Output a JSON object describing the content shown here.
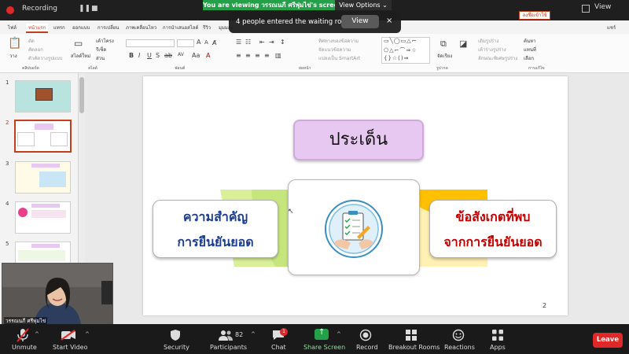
{
  "zoom_top": {
    "recording_label": "Recording",
    "viewing_banner": "You are viewing วรรณนภี ศรีพุ่มไข่'s screen",
    "view_options": "View Options",
    "view_label": "View"
  },
  "toast": {
    "message": "4 people entered the waiting room",
    "view_button": "View",
    "close": "×"
  },
  "ppt": {
    "tabs": [
      "ไฟล์",
      "หน้าแรก",
      "แทรก",
      "ออกแบบ",
      "การเปลี่ยน",
      "ภาพเคลื่อนไหว",
      "การนำเสนอสไลด์",
      "รีวิว",
      "มุมมอง"
    ],
    "share_button": "ลงชื่อเข้าใช้",
    "share_short": "แชร์",
    "groups": [
      "คลิปบอร์ด",
      "สไลด์",
      "ฟอนต์",
      "ย่อหน้า",
      "รูปวาด",
      "การแก้ไข"
    ],
    "home_buttons": {
      "paste": "วาง",
      "cut": "ตัด",
      "copy": "คัดลอก",
      "format_painter": "ตัวคัดวางรูปแบบ",
      "new_slide": "สไลด์ใหม่",
      "layout": "เค้าโครง",
      "reset": "รีเซ็ต",
      "section": "ส่วน",
      "arrange": "จัดเรียง",
      "find": "ค้นหา",
      "replace": "แทนที่",
      "select": "เลือก",
      "text_direction": "ทิศทางของข้อความ",
      "align_text": "จัดแนวข้อความ",
      "smartart": "แปลงเป็น SmartArt",
      "shape_fill": "เติมรูปร่าง",
      "shape_outline": "เค้าร่างรูปร่าง",
      "shape_effects": "ลักษณะพิเศษรูปร่าง"
    },
    "thumb_numbers": [
      "1",
      "2",
      "3",
      "4",
      "5"
    ],
    "slide": {
      "title": "ประเด็น",
      "left_line1": "ความสำคัญ",
      "left_line2": "การยืนยันยอด",
      "right_line1": "ข้อสังเกตที่พบ",
      "right_line2": "จากการยืนยันยอด",
      "page_number": "2"
    },
    "colors": {
      "title_fill": "#e7c8f0",
      "left_text": "#1c3c8c",
      "right_text": "#c00000",
      "green_band": "#c5e77a",
      "yellow_band": "#ffc000"
    }
  },
  "video": {
    "participant_name": "วรรณนภี ศรีพุ่มไข่"
  },
  "toolbar": {
    "unmute": "Unmute",
    "start_video": "Start Video",
    "security": "Security",
    "participants": "Participants",
    "participants_count": "82",
    "chat": "Chat",
    "chat_badge": "1",
    "share_screen": "Share Screen",
    "record": "Record",
    "breakout_rooms": "Breakout Rooms",
    "reactions": "Reactions",
    "apps": "Apps",
    "leave": "Leave",
    "icons": [
      "microphone-muted-icon",
      "video-off-icon",
      "shield-icon",
      "people-icon",
      "chat-icon",
      "share-screen-icon",
      "record-icon",
      "breakout-rooms-icon",
      "reactions-icon",
      "apps-icon"
    ]
  }
}
